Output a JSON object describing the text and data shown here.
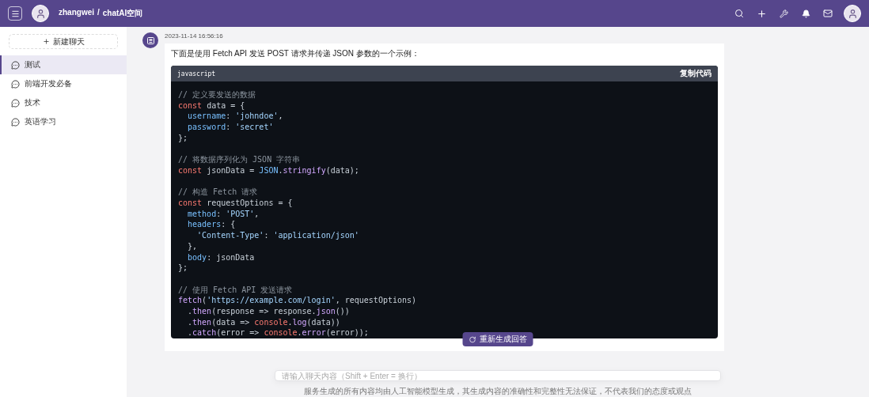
{
  "header": {
    "user": "zhangwei",
    "separator": "/",
    "space": "chatAI空间"
  },
  "sidebar": {
    "new_chat": "新建聊天",
    "items": [
      {
        "label": "测试",
        "selected": true
      },
      {
        "label": "前端开发必备",
        "selected": false
      },
      {
        "label": "技术",
        "selected": false
      },
      {
        "label": "英语学习",
        "selected": false
      }
    ]
  },
  "message": {
    "time": "2023-11-14 16:56:16",
    "intro": "下面是使用 Fetch API 发送 POST 请求并传递 JSON 参数的一个示例：",
    "code": {
      "language": "javascript",
      "copy": "复制代码",
      "paragraphs": [
        [
          [
            {
              "kind": "comment",
              "text": "// 定义要发送的数据"
            }
          ],
          [
            {
              "kind": "keyword",
              "text": "const"
            },
            {
              "kind": "plain",
              "text": " data = {"
            }
          ],
          [
            {
              "kind": "property",
              "text": "  username"
            },
            {
              "kind": "plain",
              "text": ": "
            },
            {
              "kind": "string",
              "text": "'johndoe'"
            },
            {
              "kind": "plain",
              "text": ","
            }
          ],
          [
            {
              "kind": "property",
              "text": "  password"
            },
            {
              "kind": "plain",
              "text": ": "
            },
            {
              "kind": "string",
              "text": "'secret'"
            }
          ],
          [
            {
              "kind": "plain",
              "text": "};"
            }
          ]
        ],
        [
          [
            {
              "kind": "comment",
              "text": "// 将数据序列化为 JSON 字符串"
            }
          ],
          [
            {
              "kind": "keyword",
              "text": "const"
            },
            {
              "kind": "plain",
              "text": " jsonData = "
            },
            {
              "kind": "property",
              "text": "JSON"
            },
            {
              "kind": "plain",
              "text": "."
            },
            {
              "kind": "func",
              "text": "stringify"
            },
            {
              "kind": "plain",
              "text": "(data);"
            }
          ]
        ],
        [
          [
            {
              "kind": "comment",
              "text": "// 构造 Fetch 请求"
            }
          ],
          [
            {
              "kind": "keyword",
              "text": "const"
            },
            {
              "kind": "plain",
              "text": " requestOptions = {"
            }
          ],
          [
            {
              "kind": "property",
              "text": "  method"
            },
            {
              "kind": "plain",
              "text": ": "
            },
            {
              "kind": "string",
              "text": "'POST'"
            },
            {
              "kind": "plain",
              "text": ","
            }
          ],
          [
            {
              "kind": "property",
              "text": "  headers"
            },
            {
              "kind": "plain",
              "text": ": {"
            }
          ],
          [
            {
              "kind": "string",
              "text": "    'Content-Type'"
            },
            {
              "kind": "plain",
              "text": ": "
            },
            {
              "kind": "string",
              "text": "'application/json'"
            }
          ],
          [
            {
              "kind": "plain",
              "text": "  },"
            }
          ],
          [
            {
              "kind": "property",
              "text": "  body"
            },
            {
              "kind": "plain",
              "text": ": jsonData"
            }
          ],
          [
            {
              "kind": "plain",
              "text": "};"
            }
          ]
        ],
        [
          [
            {
              "kind": "comment",
              "text": "// 使用 Fetch API 发送请求"
            }
          ],
          [
            {
              "kind": "func",
              "text": "fetch"
            },
            {
              "kind": "plain",
              "text": "("
            },
            {
              "kind": "string",
              "text": "'https://example.com/login'"
            },
            {
              "kind": "plain",
              "text": ", requestOptions)"
            }
          ],
          [
            {
              "kind": "plain",
              "text": "  ."
            },
            {
              "kind": "func",
              "text": "then"
            },
            {
              "kind": "plain",
              "text": "(response => response."
            },
            {
              "kind": "func",
              "text": "json"
            },
            {
              "kind": "plain",
              "text": "())"
            }
          ],
          [
            {
              "kind": "plain",
              "text": "  ."
            },
            {
              "kind": "func",
              "text": "then"
            },
            {
              "kind": "plain",
              "text": "(data => "
            },
            {
              "kind": "keyword",
              "text": "console"
            },
            {
              "kind": "plain",
              "text": "."
            },
            {
              "kind": "func",
              "text": "log"
            },
            {
              "kind": "plain",
              "text": "(data))"
            }
          ],
          [
            {
              "kind": "plain",
              "text": "  ."
            },
            {
              "kind": "func",
              "text": "catch"
            },
            {
              "kind": "plain",
              "text": "(error => "
            },
            {
              "kind": "keyword",
              "text": "console"
            },
            {
              "kind": "plain",
              "text": "."
            },
            {
              "kind": "func",
              "text": "error"
            },
            {
              "kind": "plain",
              "text": "(error));"
            }
          ]
        ]
      ]
    }
  },
  "regenerate": "重新生成回答",
  "input": {
    "placeholder": "请输入聊天内容（Shift + Enter = 换行）"
  },
  "disclaimer": "服务生成的所有内容均由人工智能模型生成，其生成内容的准确性和完整性无法保证，不代表我们的态度或观点"
}
